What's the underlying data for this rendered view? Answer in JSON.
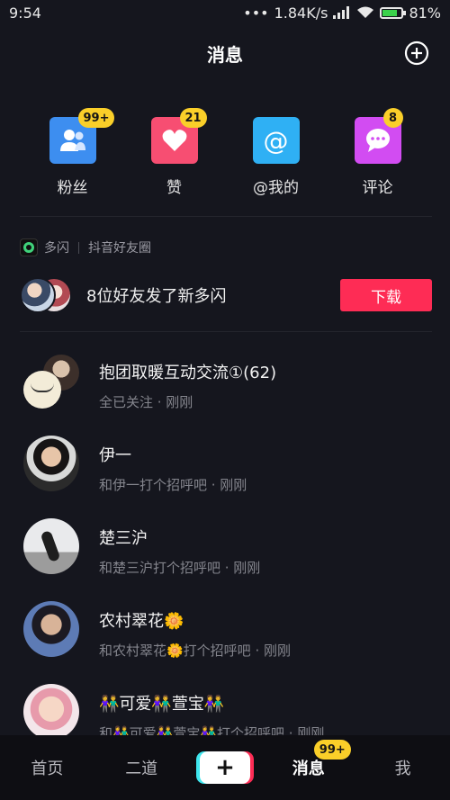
{
  "status_bar": {
    "time": "9:54",
    "dots": "•••",
    "network_speed": "1.84K/s",
    "battery": "81%"
  },
  "header": {
    "title": "消息",
    "add_icon": "plus-circle-icon"
  },
  "quick_actions": [
    {
      "label": "粉丝",
      "badge": "99+",
      "color": "#3d8ef0",
      "icon": "fans-icon"
    },
    {
      "label": "赞",
      "badge": "21",
      "color": "#f74e72",
      "icon": "heart-icon"
    },
    {
      "label": "@我的",
      "badge": "",
      "color": "#2fb0f4",
      "icon": "at-icon"
    },
    {
      "label": "评论",
      "badge": "8",
      "color": "#d24cf2",
      "icon": "comment-icon"
    }
  ],
  "duoshan": {
    "app_name": "多闪",
    "subtitle": "抖音好友圈",
    "friends_text": "8位好友发了新多闪",
    "download_label": "下载"
  },
  "conversations": [
    {
      "name": "抱团取暖互动交流①(62)",
      "subtitle": "全已关注 · 刚刚"
    },
    {
      "name": "伊一",
      "subtitle": "和伊一打个招呼吧 · 刚刚"
    },
    {
      "name": "楚三沪",
      "subtitle": "和楚三沪打个招呼吧 · 刚刚"
    },
    {
      "name": "农村翠花🌼",
      "subtitle": "和农村翠花🌼打个招呼吧 · 刚刚"
    },
    {
      "name": "👫可爱👫萱宝👫",
      "subtitle": "和👫可爱👫萱宝👫打个招呼吧 · 刚刚"
    }
  ],
  "bottom_nav": {
    "home": "首页",
    "second": "二道",
    "plus": "+",
    "messages": "消息",
    "messages_badge": "99+",
    "me": "我"
  }
}
